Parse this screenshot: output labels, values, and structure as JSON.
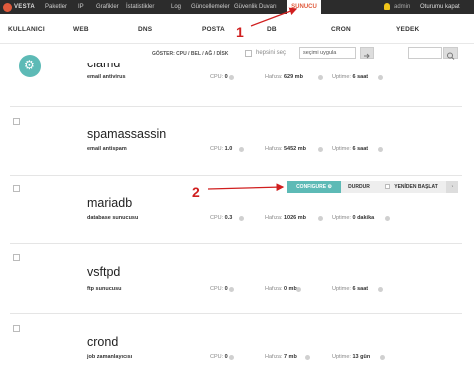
{
  "topbar": {
    "logo_text": "VESTA",
    "menu": [
      "Paketler",
      "IP",
      "Grafikler",
      "İstatistikler",
      "Log",
      "Güncellemeler",
      "Güvenlik Duvarı",
      "SUNUCU"
    ],
    "active": "SUNUCU",
    "user": "admin",
    "logout": "Oturumu kapat"
  },
  "categories": [
    "KULLANICI",
    "WEB",
    "DNS",
    "POSTA",
    "DB",
    "CRON",
    "YEDEK"
  ],
  "toolbar": {
    "show_label": "GÖSTER: CPU / BEL / AĞ / DİSK",
    "select_all_label": "hepsini seç",
    "bulk_select_value": "seçimi uygula"
  },
  "services": [
    {
      "name": "clamd",
      "desc": "email antivirus",
      "cpu_label": "CPU:",
      "cpu": "0",
      "mem_label": "Hafıza:",
      "mem": "629 mb",
      "up_label": "Uptime:",
      "up": "6 saat"
    },
    {
      "name": "spamassassin",
      "desc": "email antispam",
      "cpu_label": "CPU:",
      "cpu": "1.0",
      "mem_label": "Hafıza:",
      "mem": "5452 mb",
      "up_label": "Uptime:",
      "up": "6 saat"
    },
    {
      "name": "mariadb",
      "desc": "database sunucusu",
      "cpu_label": "CPU:",
      "cpu": "0.3",
      "mem_label": "Hafıza:",
      "mem": "1026 mb",
      "up_label": "Uptime:",
      "up": "0 dakika"
    },
    {
      "name": "vsftpd",
      "desc": "ftp sunucusu",
      "cpu_label": "CPU:",
      "cpu": "0",
      "mem_label": "Hafıza:",
      "mem": "0 mb",
      "up_label": "Uptime:",
      "up": "6 saat"
    },
    {
      "name": "crond",
      "desc": "job zamanlayıcısı",
      "cpu_label": "CPU:",
      "cpu": "0",
      "mem_label": "Hafıza:",
      "mem": "7 mb",
      "up_label": "Uptime:",
      "up": "13 gün"
    }
  ],
  "actions": {
    "configure": "CONFIGURE",
    "stop": "DURDUR",
    "restart": "YENİDEN BAŞLAT"
  },
  "annotations": [
    "1",
    "2"
  ],
  "colors": {
    "accent": "#5dbab6",
    "active_menu": "#e05a3c",
    "annotation": "#d01f1f"
  }
}
